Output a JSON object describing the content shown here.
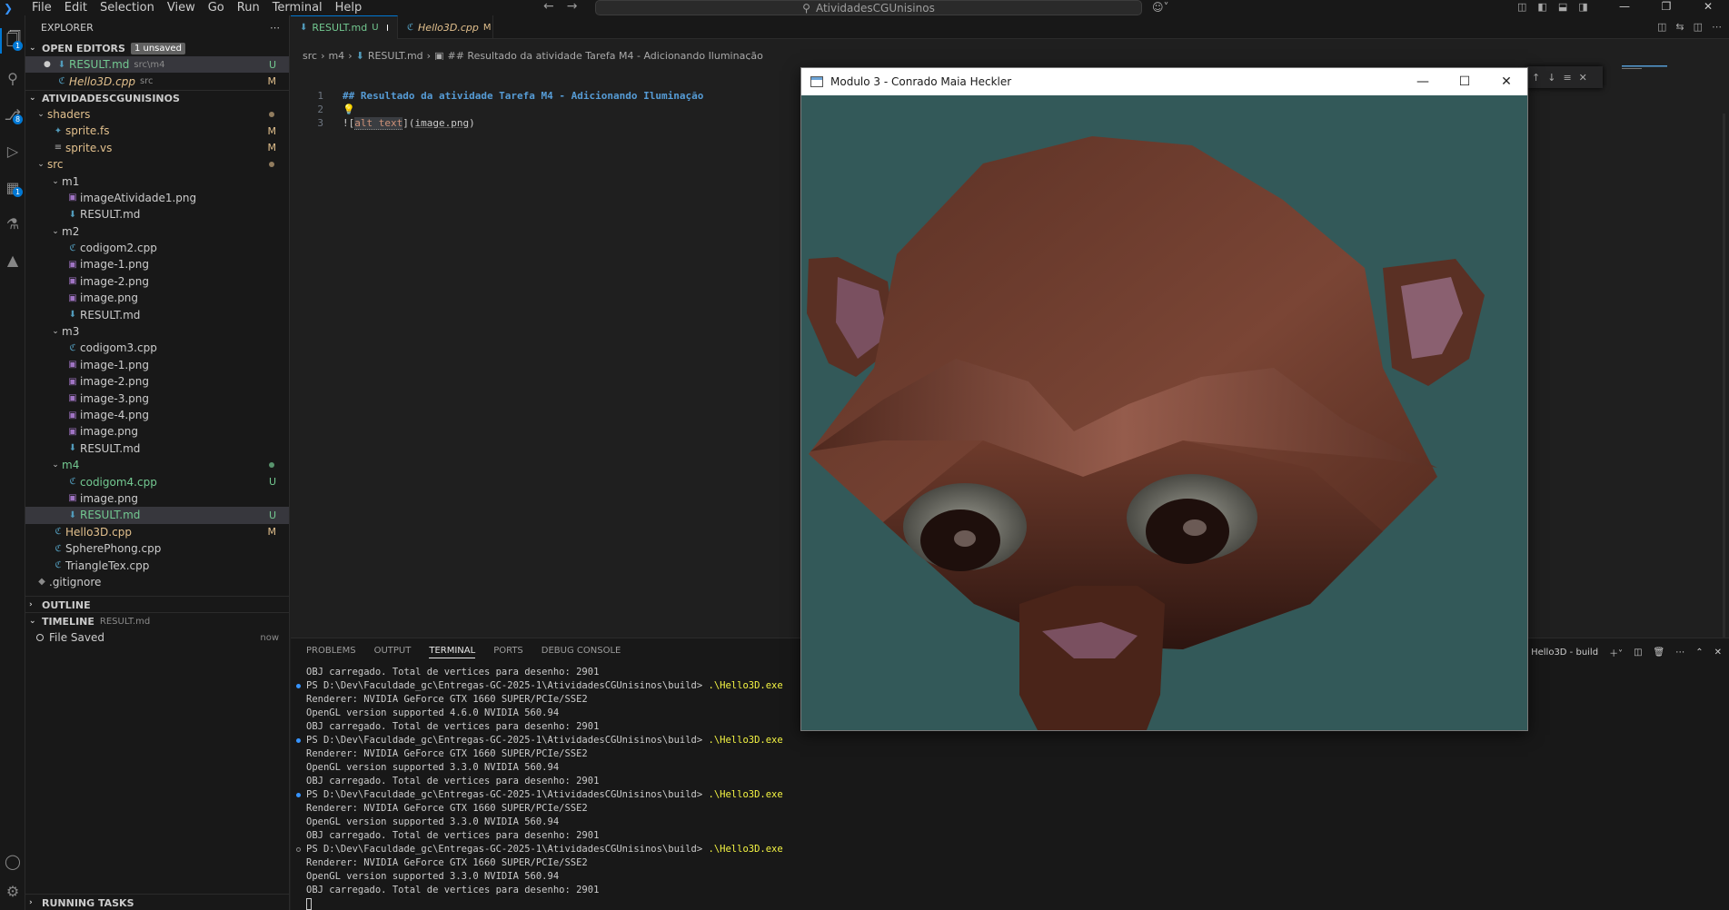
{
  "titlebar": {
    "menu": [
      "File",
      "Edit",
      "Selection",
      "View",
      "Go",
      "Run",
      "Terminal",
      "Help"
    ],
    "search_text": "AtividadesCGUnisinos"
  },
  "activity_bar": {
    "explorer_badge": "1",
    "scm_badge": "8",
    "extensions_badge": "1"
  },
  "sidebar": {
    "title": "EXPLORER",
    "open_editors": {
      "label": "OPEN EDITORS",
      "badge": "1 unsaved",
      "items": [
        {
          "name": "RESULT.md",
          "desc": "src\\m4",
          "status": "U"
        },
        {
          "name": "Hello3D.cpp",
          "desc": "src",
          "status": "M"
        }
      ]
    },
    "workspace": {
      "label": "ATIVIDADESCGUNISINOS",
      "items": [
        {
          "name": "shaders",
          "status": ""
        },
        {
          "name": "sprite.fs",
          "status": "M"
        },
        {
          "name": "sprite.vs",
          "status": "M"
        },
        {
          "name": "src",
          "status": ""
        },
        {
          "name": "m1",
          "status": ""
        },
        {
          "name": "imageAtividade1.png",
          "status": ""
        },
        {
          "name": "RESULT.md",
          "status": ""
        },
        {
          "name": "m2",
          "status": ""
        },
        {
          "name": "codigom2.cpp",
          "status": ""
        },
        {
          "name": "image-1.png",
          "status": ""
        },
        {
          "name": "image-2.png",
          "status": ""
        },
        {
          "name": "image.png",
          "status": ""
        },
        {
          "name": "RESULT.md",
          "status": ""
        },
        {
          "name": "m3",
          "status": ""
        },
        {
          "name": "codigom3.cpp",
          "status": ""
        },
        {
          "name": "image-1.png",
          "status": ""
        },
        {
          "name": "image-2.png",
          "status": ""
        },
        {
          "name": "image-3.png",
          "status": ""
        },
        {
          "name": "image-4.png",
          "status": ""
        },
        {
          "name": "image.png",
          "status": ""
        },
        {
          "name": "RESULT.md",
          "status": ""
        },
        {
          "name": "m4",
          "status": ""
        },
        {
          "name": "codigom4.cpp",
          "status": "U"
        },
        {
          "name": "image.png",
          "status": ""
        },
        {
          "name": "RESULT.md",
          "status": "U"
        },
        {
          "name": "Hello3D.cpp",
          "status": "M"
        },
        {
          "name": "SpherePhong.cpp",
          "status": ""
        },
        {
          "name": "TriangleTex.cpp",
          "status": ""
        },
        {
          "name": ".gitignore",
          "status": ""
        }
      ]
    },
    "outline_label": "OUTLINE",
    "timeline": {
      "label": "TIMELINE",
      "file": "RESULT.md",
      "items": [
        {
          "label": "File Saved",
          "when": "now"
        }
      ]
    },
    "running_tasks_label": "RUNNING TASKS"
  },
  "tabs": [
    {
      "label": "RESULT.md",
      "status": "U"
    },
    {
      "label": "Hello3D.cpp",
      "status": "M"
    }
  ],
  "breadcrumb": {
    "parts": [
      "src",
      "m4",
      "RESULT.md",
      "## Resultado da atividade Tarefa M4 - Adicionando Iluminação"
    ]
  },
  "editor": {
    "line_numbers": [
      "1",
      "2",
      "3"
    ],
    "line1": "## Resultado da atividade Tarefa M4 - Adicionando Iluminação",
    "line3_prefix": "![",
    "line3_alt": "alt text",
    "line3_mid": "](",
    "line3_link": "image.png",
    "line3_suffix": ")"
  },
  "panel": {
    "tabs": [
      "PROBLEMS",
      "OUTPUT",
      "TERMINAL",
      "PORTS",
      "DEBUG CONSOLE"
    ],
    "terminal_name": "Hello3D - build",
    "lines": [
      {
        "mark": "",
        "text": "OBJ carregado. Total de vertices para desenho: 2901",
        "cmd": ""
      },
      {
        "mark": "blue",
        "text": "PS D:\\Dev\\Faculdade_gc\\Entregas-GC-2025-1\\AtividadesCGUnisinos\\build> ",
        "cmd": ".\\Hello3D.exe"
      },
      {
        "mark": "",
        "text": "Renderer: NVIDIA GeForce GTX 1660 SUPER/PCIe/SSE2",
        "cmd": ""
      },
      {
        "mark": "",
        "text": "OpenGL version supported 4.6.0 NVIDIA 560.94",
        "cmd": ""
      },
      {
        "mark": "",
        "text": "OBJ carregado. Total de vertices para desenho: 2901",
        "cmd": ""
      },
      {
        "mark": "blue",
        "text": "PS D:\\Dev\\Faculdade_gc\\Entregas-GC-2025-1\\AtividadesCGUnisinos\\build> ",
        "cmd": ".\\Hello3D.exe"
      },
      {
        "mark": "",
        "text": "Renderer: NVIDIA GeForce GTX 1660 SUPER/PCIe/SSE2",
        "cmd": ""
      },
      {
        "mark": "",
        "text": "OpenGL version supported 3.3.0 NVIDIA 560.94",
        "cmd": ""
      },
      {
        "mark": "",
        "text": "OBJ carregado. Total de vertices para desenho: 2901",
        "cmd": ""
      },
      {
        "mark": "blue",
        "text": "PS D:\\Dev\\Faculdade_gc\\Entregas-GC-2025-1\\AtividadesCGUnisinos\\build> ",
        "cmd": ".\\Hello3D.exe"
      },
      {
        "mark": "",
        "text": "Renderer: NVIDIA GeForce GTX 1660 SUPER/PCIe/SSE2",
        "cmd": ""
      },
      {
        "mark": "",
        "text": "OpenGL version supported 3.3.0 NVIDIA 560.94",
        "cmd": ""
      },
      {
        "mark": "",
        "text": "OBJ carregado. Total de vertices para desenho: 2901",
        "cmd": ""
      },
      {
        "mark": "hollow",
        "text": "PS D:\\Dev\\Faculdade_gc\\Entregas-GC-2025-1\\AtividadesCGUnisinos\\build> ",
        "cmd": ".\\Hello3D.exe"
      },
      {
        "mark": "",
        "text": "Renderer: NVIDIA GeForce GTX 1660 SUPER/PCIe/SSE2",
        "cmd": ""
      },
      {
        "mark": "",
        "text": "OpenGL version supported 3.3.0 NVIDIA 560.94",
        "cmd": ""
      },
      {
        "mark": "",
        "text": "OBJ carregado. Total de vertices para desenho: 2901",
        "cmd": ""
      }
    ]
  },
  "gl_window": {
    "title": "Modulo 3 - Conrado Maia Heckler",
    "clear_color": "#335959",
    "model_color": "#6b3a2a"
  },
  "colors": {
    "accent": "#0078d4",
    "untracked": "#73c991",
    "modified": "#e2c08d"
  }
}
